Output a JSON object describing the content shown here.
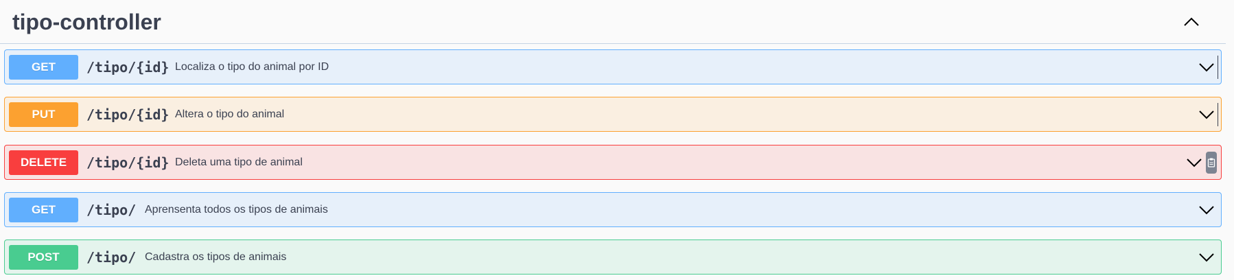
{
  "section": {
    "title": "tipo-controller",
    "collapse_icon": "chevron-up-icon"
  },
  "operations": [
    {
      "method": "GET",
      "path": "/tipo/{id}",
      "summary": "Localiza o tipo do animal por ID"
    },
    {
      "method": "PUT",
      "path": "/tipo/{id}",
      "summary": "Altera o tipo do animal"
    },
    {
      "method": "DELETE",
      "path": "/tipo/{id}",
      "summary": "Deleta uma tipo de animal"
    },
    {
      "method": "GET",
      "path": "/tipo/",
      "summary": "Aprensenta todos os tipos de animais"
    },
    {
      "method": "POST",
      "path": "/tipo/",
      "summary": "Cadastra os tipos de animais"
    }
  ],
  "icons": {
    "expand": "chevron-down-icon",
    "copy": "clipboard-icon"
  },
  "colors": {
    "get": "#61affe",
    "put": "#fca130",
    "delete": "#f93e3e",
    "post": "#49cc90"
  }
}
